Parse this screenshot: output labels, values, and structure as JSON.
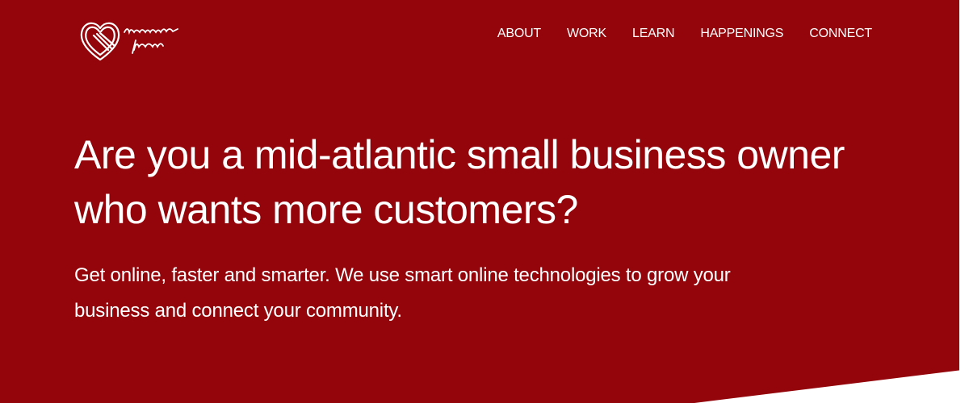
{
  "brand": {
    "logo_icon": "heart-logo-icon",
    "logo_text_line1": "benevolent",
    "logo_text_line2": "tech"
  },
  "nav": {
    "items": [
      {
        "label": "ABOUT"
      },
      {
        "label": "WORK"
      },
      {
        "label": "LEARN"
      },
      {
        "label": "HAPPENINGS"
      },
      {
        "label": "CONNECT"
      }
    ]
  },
  "hero": {
    "headline": "Are you a mid-atlantic small business owner who wants more customers?",
    "subtext": "Get online, faster and smarter. We use smart online technologies to grow your business and connect your community."
  },
  "colors": {
    "background": "#93050b",
    "text": "#ffffff",
    "accent_white": "#ffffff"
  }
}
